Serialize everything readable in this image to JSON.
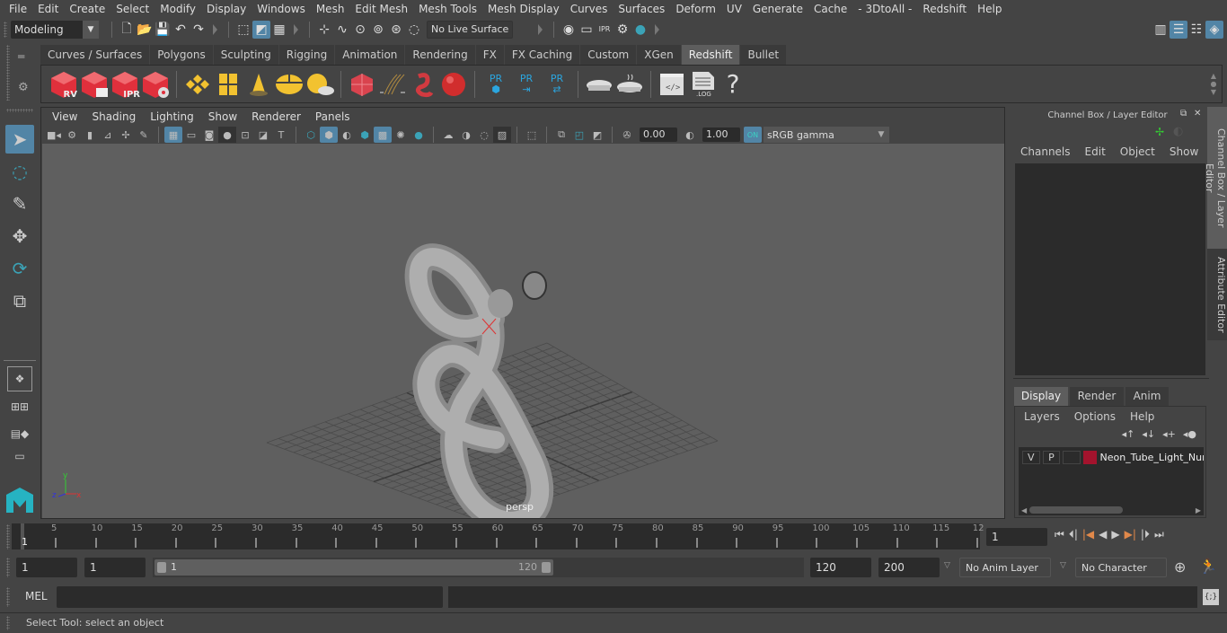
{
  "menubar": [
    "File",
    "Edit",
    "Create",
    "Select",
    "Modify",
    "Display",
    "Windows",
    "Mesh",
    "Edit Mesh",
    "Mesh Tools",
    "Mesh Display",
    "Curves",
    "Surfaces",
    "Deform",
    "UV",
    "Generate",
    "Cache",
    "- 3DtoAll -",
    "Redshift",
    "Help"
  ],
  "statusline": {
    "workspace": "Modeling",
    "live_surface": "No Live Surface"
  },
  "shelf": {
    "tabs": [
      "Curves / Surfaces",
      "Polygons",
      "Sculpting",
      "Rigging",
      "Animation",
      "Rendering",
      "FX",
      "FX Caching",
      "Custom",
      "XGen",
      "Redshift",
      "Bullet"
    ],
    "active_tab": "Redshift",
    "icons": [
      {
        "name": "redshift-render-view-icon",
        "label": "RV"
      },
      {
        "name": "redshift-batch-render-icon",
        "label": ""
      },
      {
        "name": "redshift-ipr-icon",
        "label": "IPR"
      },
      {
        "name": "redshift-render-settings-icon",
        "label": ""
      },
      {
        "name": "rs-area-light-icon",
        "label": ""
      },
      {
        "name": "rs-portal-light-icon",
        "label": ""
      },
      {
        "name": "rs-ies-light-icon",
        "label": ""
      },
      {
        "name": "rs-dome-light-icon",
        "label": ""
      },
      {
        "name": "rs-sun-sky-icon",
        "label": ""
      },
      {
        "name": "rs-proxy-icon",
        "label": ""
      },
      {
        "name": "rs-hair-icon",
        "label": ""
      },
      {
        "name": "rs-mesh-light-icon",
        "label": ""
      },
      {
        "name": "rs-material-icon",
        "label": ""
      },
      {
        "name": "rs-pr-create-icon",
        "label": "PR"
      },
      {
        "name": "rs-pr-export-icon",
        "label": "PR"
      },
      {
        "name": "rs-pr-swap-icon",
        "label": "PR"
      },
      {
        "name": "rs-bake-icon",
        "label": ""
      },
      {
        "name": "rs-bake-settings-icon",
        "label": ""
      },
      {
        "name": "rs-script-editor-icon",
        "label": ""
      },
      {
        "name": "rs-log-icon",
        "label": ".LOG"
      },
      {
        "name": "help-icon",
        "label": "?"
      }
    ]
  },
  "viewport": {
    "menu": [
      "View",
      "Shading",
      "Lighting",
      "Show",
      "Renderer",
      "Panels"
    ],
    "exposure": "0.00",
    "gamma": "1.00",
    "color_space": "sRGB gamma",
    "camera_label": "persp",
    "axis": {
      "x": "x",
      "y": "y",
      "z": "z"
    }
  },
  "channel_box": {
    "title": "Channel Box / Layer Editor",
    "menu": [
      "Channels",
      "Edit",
      "Object",
      "Show"
    ]
  },
  "layer_editor": {
    "tabs": [
      "Display",
      "Render",
      "Anim"
    ],
    "active_tab": "Display",
    "menu": [
      "Layers",
      "Options",
      "Help"
    ],
    "layers": [
      {
        "v": "V",
        "p": "P",
        "color": "#a3132d",
        "name": "Neon_Tube_Light_Nur"
      }
    ]
  },
  "side_tabs": [
    "Channel Box / Layer Editor",
    "Attribute Editor"
  ],
  "timeline": {
    "ticks": [
      "5",
      "10",
      "15",
      "20",
      "25",
      "30",
      "35",
      "40",
      "45",
      "50",
      "55",
      "60",
      "65",
      "70",
      "75",
      "80",
      "85",
      "90",
      "95",
      "100",
      "105",
      "110",
      "115",
      "12"
    ],
    "current_frame_marker": "1",
    "current_frame": "1"
  },
  "range": {
    "start": "1",
    "anim_start": "1",
    "slider_start": "1",
    "slider_end": "120",
    "end": "120",
    "anim_end": "200",
    "anim_layer": "No Anim Layer",
    "character_set": "No Character Set"
  },
  "mel": {
    "label": "MEL"
  },
  "help_line": "Select Tool: select an object",
  "colors": {
    "accent": "#5285a6",
    "layer_color": "#a3132d",
    "redshift_red": "#e0303c",
    "light_yellow": "#f2c230",
    "pr_blue": "#2ba6e0"
  }
}
